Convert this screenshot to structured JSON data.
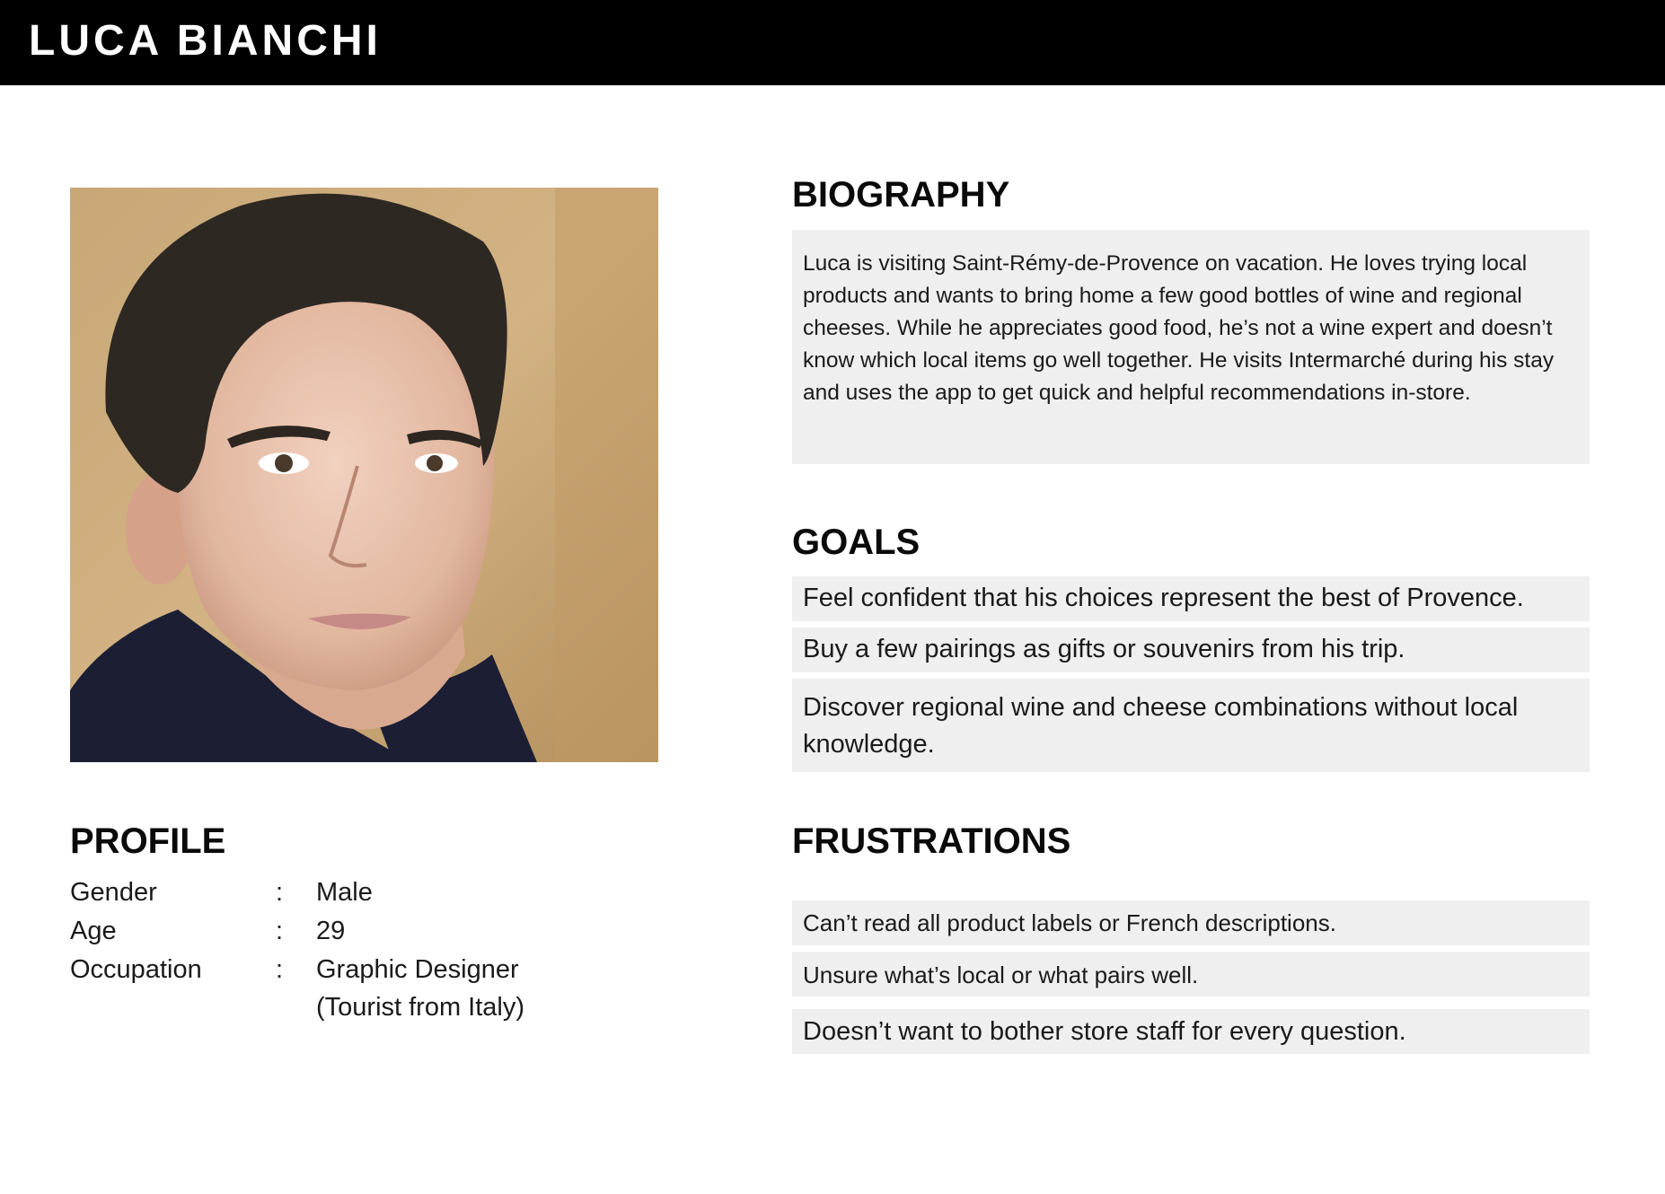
{
  "header": {
    "title": "LUCA BIANCHI"
  },
  "photo": {
    "alt": "portrait photo"
  },
  "profile": {
    "title": "PROFILE",
    "fields": [
      {
        "label": "Gender",
        "value": "Male"
      },
      {
        "label": "Age",
        "value": "29"
      },
      {
        "label": "Occupation",
        "value": "Graphic Designer",
        "value_extra": "(Tourist from Italy)"
      }
    ],
    "separator": ":"
  },
  "biography": {
    "title": "BIOGRAPHY",
    "text": "Luca is visiting Saint-Rémy-de-Provence on vacation. He loves trying local products and wants to bring home a few good bottles of wine and regional cheeses. While he appreciates good food, he’s not a wine expert and doesn’t know which local items go well together. He visits Intermarché during his stay and uses the app to get quick and helpful recommendations in-store."
  },
  "goals": {
    "title": "GOALS",
    "items": [
      "Feel confident that his choices represent the best of Provence.",
      "Buy a few pairings as gifts or souvenirs from his trip.",
      "Discover regional wine and cheese combinations without local knowledge."
    ]
  },
  "frustrations": {
    "title": "FRUSTRATIONS",
    "items": [
      "Can’t read all product labels or French descriptions.",
      "Unsure what’s local or what pairs well.",
      "Doesn’t want to bother store staff for every question."
    ]
  },
  "colors": {
    "header_bg": "#000000",
    "header_text": "#ffffff",
    "box_bg": "#efefef",
    "text": "#111111"
  }
}
